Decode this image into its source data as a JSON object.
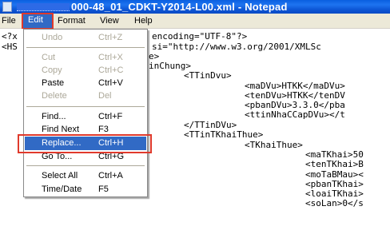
{
  "window": {
    "title_suffix": "000-48_01_CDKT-Y2014-L00.xml - Notepad"
  },
  "menubar": {
    "file": "File",
    "edit": "Edit",
    "format": "Format",
    "view": "View",
    "help": "Help"
  },
  "edit_menu": {
    "items": [
      {
        "label": "Undo",
        "shortcut": "Ctrl+Z",
        "enabled": false
      },
      {
        "label": "Cut",
        "shortcut": "Ctrl+X",
        "enabled": false
      },
      {
        "label": "Copy",
        "shortcut": "Ctrl+C",
        "enabled": false
      },
      {
        "label": "Paste",
        "shortcut": "Ctrl+V",
        "enabled": true
      },
      {
        "label": "Delete",
        "shortcut": "Del",
        "enabled": false
      },
      {
        "label": "Find...",
        "shortcut": "Ctrl+F",
        "enabled": true
      },
      {
        "label": "Find Next",
        "shortcut": "F3",
        "enabled": true
      },
      {
        "label": "Replace...",
        "shortcut": "Ctrl+H",
        "enabled": true,
        "highlighted": true
      },
      {
        "label": "Go To...",
        "shortcut": "Ctrl+G",
        "enabled": true
      },
      {
        "label": "Select All",
        "shortcut": "Ctrl+A",
        "enabled": true
      },
      {
        "label": "Time/Date",
        "shortcut": "F5",
        "enabled": true
      }
    ]
  },
  "editor": {
    "lines": [
      "<?x",
      "encoding=\"UTF-8\"?>",
      "<HS",
      "si=\"http://www.w3.org/2001/XMLSc",
      "e>",
      "inChung>",
      "<TTinDvu>",
      "<maDVu>HTKK</maDVu>",
      "<tenDVu>HTKK</tenDV",
      "<pbanDVu>3.3.0</pba",
      "<ttinNhaCCapDVu></t",
      "</TTinDVu>",
      "<TTinTKhaiThue>",
      "<TKhaiThue>",
      "<maTKhai>50",
      "<tenTKhai>B",
      "<moTaBMau><",
      "<pbanTKhai>",
      "<loaiTKhai>",
      "<soLan>0</s"
    ]
  },
  "colors": {
    "titlebar": "#0a5fe0",
    "menu_highlight": "#316ac5",
    "annotation_box": "#e03a2c"
  }
}
